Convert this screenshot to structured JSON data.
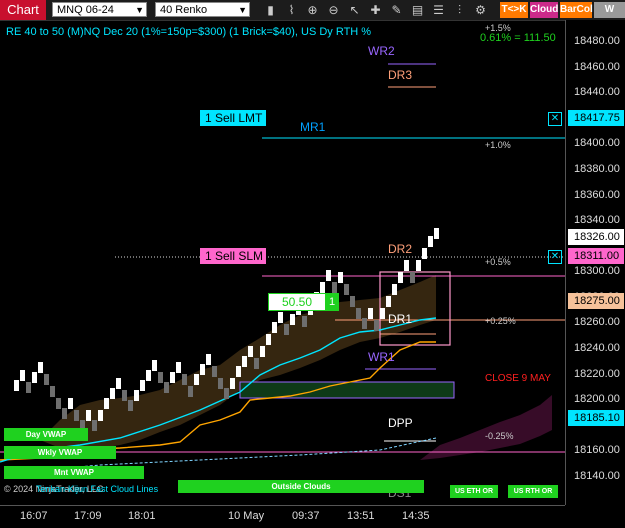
{
  "toolbar": {
    "tab": "Chart",
    "instrument": "MNQ 06-24",
    "bar_type": "40 Renko",
    "buttons": [
      "bars-icon",
      "zoom-in-icon",
      "zoom-out-icon",
      "pointer-icon",
      "crosshair-icon",
      "draw-icon",
      "data-box-icon",
      "properties-icon",
      "indicators-icon",
      "strategies-icon",
      "chart-trader-icon"
    ],
    "badges": [
      {
        "label": "T<>K",
        "color": "#ff7a00"
      },
      {
        "label": "Cloud",
        "color": "#cc2a8a"
      },
      {
        "label": "BarCol",
        "color": "#ff7a00"
      },
      {
        "label": "W VWA",
        "color": "#9a9a9a"
      }
    ]
  },
  "chart": {
    "info": "RE 40 to 50 (M)NQ Dec 20 (1%=150p=$300) (1 Brick=$40), US Dy RTH %",
    "pct_readout": "0.61% = 111.50",
    "levels": {
      "wr2": "WR2",
      "dr3": "DR3",
      "mr1": "MR1",
      "dr2": "DR2",
      "dr1": "DR1",
      "wr1": "WR1",
      "dpp": "DPP",
      "ds1": "DS1"
    },
    "pct_labels": [
      "+1.5%",
      "+1.0%",
      "+0.5%",
      "+0.25%",
      "-0.25%"
    ],
    "close_label": "CLOSE 9 MAY",
    "orders": [
      {
        "label": "1 Sell LMT",
        "price": "18417.75"
      },
      {
        "label": "1 Sell SLM",
        "price": "18311.00"
      }
    ],
    "position": {
      "value": "50.50",
      "qty": "1"
    },
    "last_price": "18326.00",
    "avg_price": "18275.00",
    "vwap_price": "18185.10",
    "bottom_labels": [
      "Day VWAP",
      "Wkly VWAP",
      "Mnt VWAP",
      "Outside Clouds",
      "US ETH OR",
      "US RTH OR"
    ],
    "copyright": "© 2024 NinjaTrader, LLC",
    "overlay_text": "Tenkan-Kijun Fast Cloud Lines",
    "y_ticks": [
      {
        "label": "18480.00",
        "p": 18480
      },
      {
        "label": "18460.00",
        "p": 18460
      },
      {
        "label": "18440.00",
        "p": 18440
      },
      {
        "label": "18400.00",
        "p": 18400
      },
      {
        "label": "18380.00",
        "p": 18380
      },
      {
        "label": "18360.00",
        "p": 18360
      },
      {
        "label": "18340.00",
        "p": 18340
      },
      {
        "label": "18300.00",
        "p": 18300
      },
      {
        "label": "18280.00",
        "p": 18280
      },
      {
        "label": "18260.00",
        "p": 18260
      },
      {
        "label": "18240.00",
        "p": 18240
      },
      {
        "label": "18220.00",
        "p": 18220
      },
      {
        "label": "18200.00",
        "p": 18200
      },
      {
        "label": "18160.00",
        "p": 18160
      },
      {
        "label": "18140.00",
        "p": 18140
      }
    ],
    "x_ticks": [
      "16:07",
      "17:09",
      "18:01",
      "10 May",
      "09:37",
      "13:51",
      "14:35"
    ]
  },
  "colors": {
    "cyan": "#00e5ff",
    "pink": "#ff66cc",
    "orange": "#ffa500",
    "green": "#1fd11f",
    "purple": "#9966ff"
  }
}
